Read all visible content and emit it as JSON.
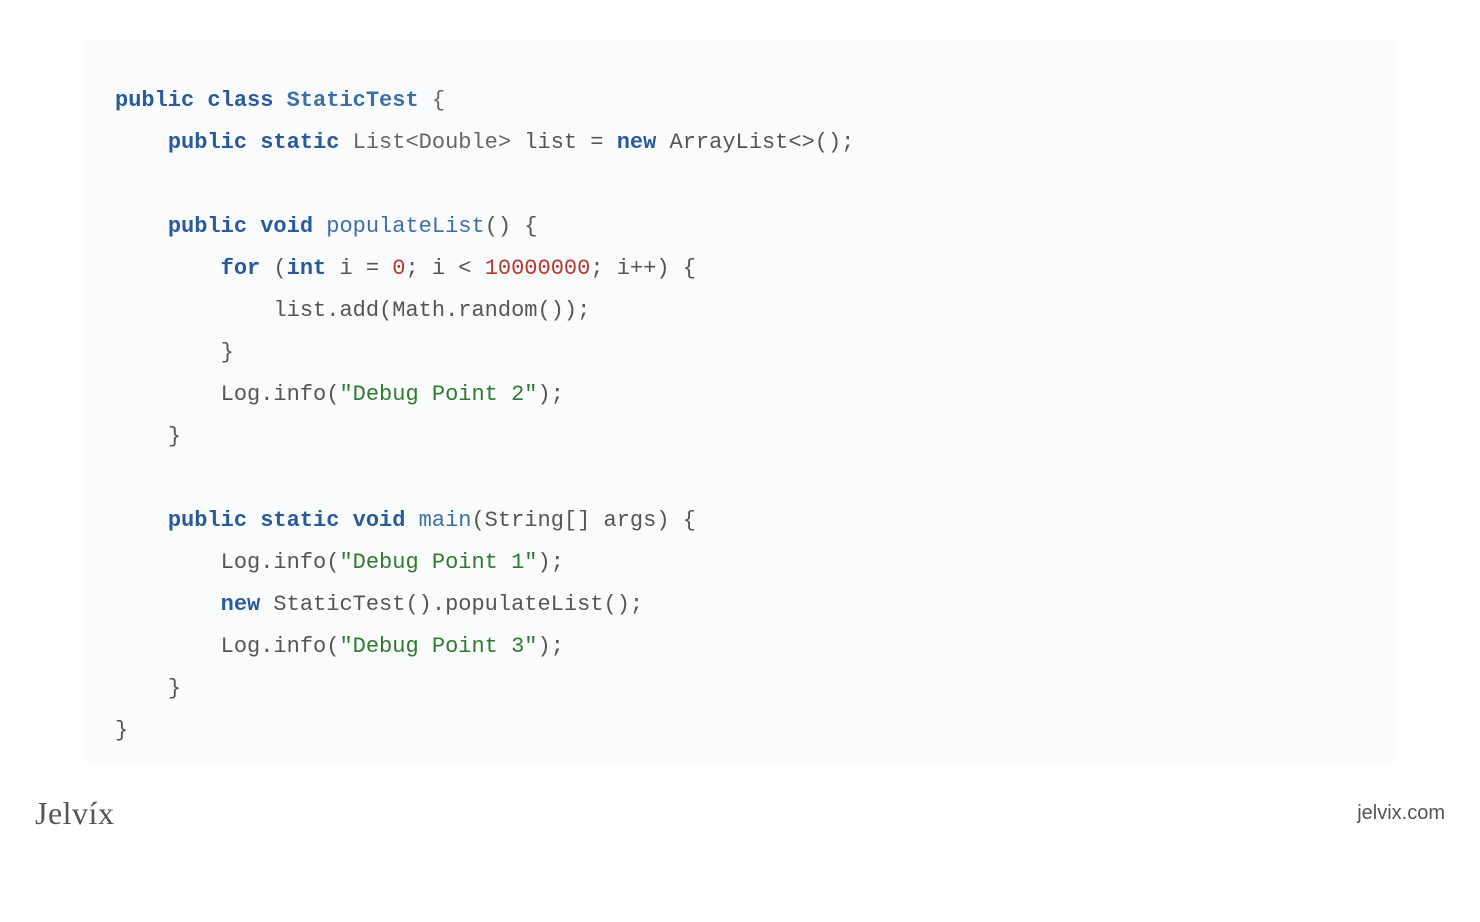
{
  "code": {
    "l1_public": "public",
    "l1_class": "class",
    "l1_name": "StaticTest",
    "l1_brace": " {",
    "l2_public": "public",
    "l2_static": "static",
    "l2_type": "List<Double>",
    "l2_var": " list = ",
    "l2_new": "new",
    "l2_call": " ArrayList<>();",
    "l4_public": "public",
    "l4_void": "void",
    "l4_name": "populateList",
    "l4_rest": "() {",
    "l5_for": "for",
    "l5_paren": " (",
    "l5_int": "int",
    "l5_init": " i = ",
    "l5_zero": "0",
    "l5_cond": "; i < ",
    "l5_limit": "10000000",
    "l5_inc": "; i++) {",
    "l6": "list.add(Math.random());",
    "l7": "}",
    "l8a": "Log.info(",
    "l8s": "\"Debug Point 2\"",
    "l8b": ");",
    "l9": "}",
    "l11_public": "public",
    "l11_static": "static",
    "l11_void": "void",
    "l11_main": "main",
    "l11_rest": "(String[] args) {",
    "l12a": "Log.info(",
    "l12s": "\"Debug Point 1\"",
    "l12b": ");",
    "l13_new": "new",
    "l13_rest": " StaticTest().populateList();",
    "l14a": "Log.info(",
    "l14s": "\"Debug Point 3\"",
    "l14b": ");",
    "l15": "}",
    "l16": "}"
  },
  "footer": {
    "brand": "Jelvíx",
    "site": "jelvix.com"
  }
}
